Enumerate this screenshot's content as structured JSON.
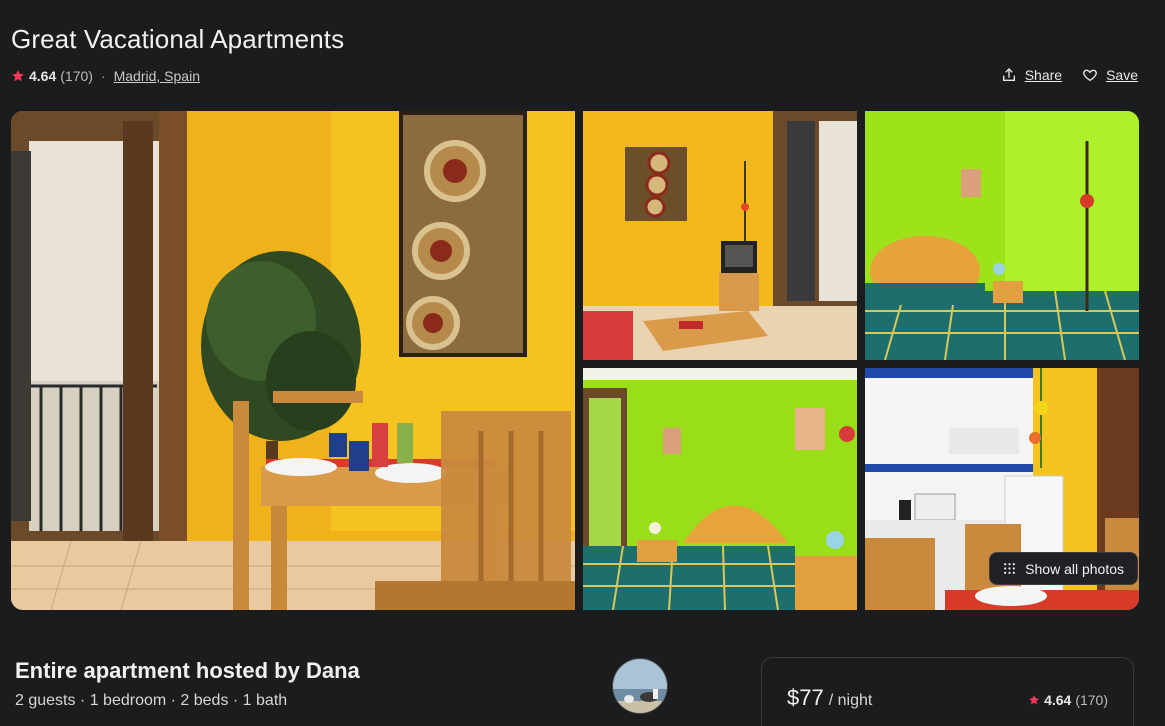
{
  "listing": {
    "title": "Great Vacational Apartments",
    "rating": "4.64",
    "reviews": "(170)",
    "separator": "·",
    "location": "Madrid, Spain"
  },
  "actions": {
    "share": "Share",
    "save": "Save"
  },
  "gallery": {
    "show_all": "Show all photos"
  },
  "host": {
    "title": "Entire apartment hosted by Dana",
    "details": "2 guests · 1 bedroom · 2 beds · 1 bath"
  },
  "booking": {
    "price": "$77",
    "per": "/ night",
    "rating": "4.64",
    "reviews": "(170)"
  },
  "colors": {
    "accent_star": "#ff385c",
    "background": "#1b1c1e"
  },
  "icons": [
    "star-icon",
    "share-icon",
    "heart-icon",
    "grid-icon"
  ]
}
